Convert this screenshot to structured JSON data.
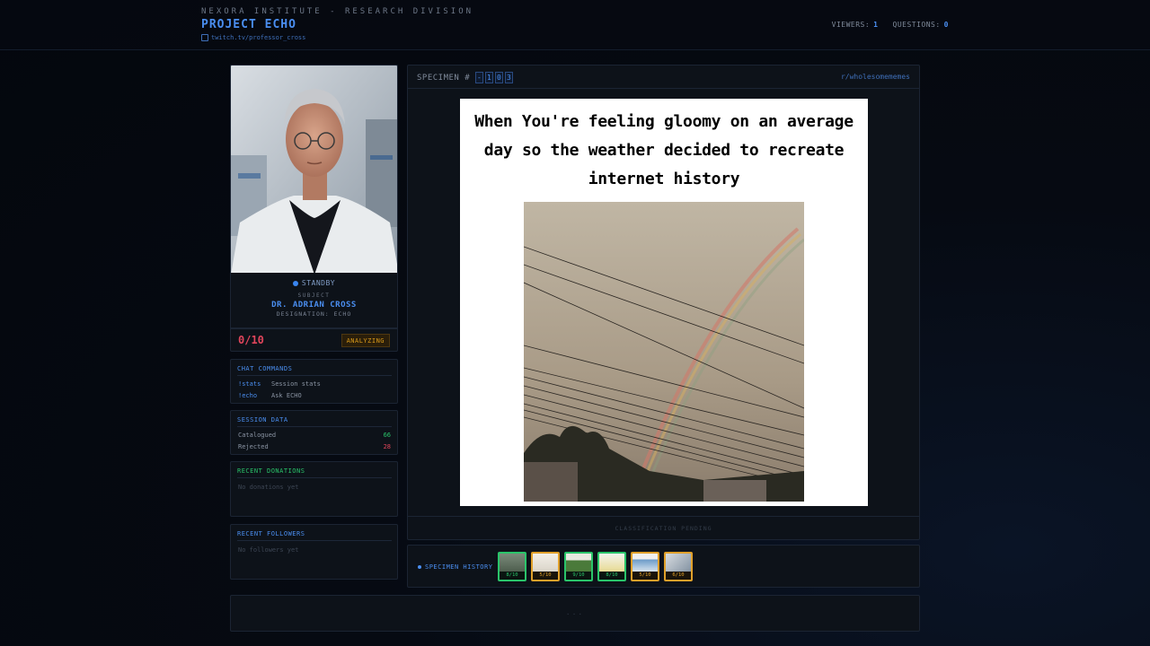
{
  "header": {
    "org": "NEXORA INSTITUTE - RESEARCH DIVISION",
    "project": "PROJECT ECHO",
    "stream": "twitch.tv/professor_cross",
    "viewers_label": "VIEWERS:",
    "viewers": "1",
    "questions_label": "QUESTIONS:",
    "questions": "0"
  },
  "subject": {
    "status": "STANDBY",
    "label": "SUBJECT",
    "name": "DR. ADRIAN CROSS",
    "designation": "DESIGNATION: ECHO",
    "score": "0/10",
    "state": "ANALYZING"
  },
  "commands": {
    "title": "CHAT COMMANDS",
    "items": [
      {
        "cmd": "!stats",
        "desc": "Session stats"
      },
      {
        "cmd": "!echo",
        "desc": "Ask ECHO"
      }
    ]
  },
  "session": {
    "title": "SESSION DATA",
    "catalogued_label": "Catalogued",
    "catalogued": "66",
    "rejected_label": "Rejected",
    "rejected": "28"
  },
  "donations": {
    "title": "RECENT DONATIONS",
    "empty": "No donations yet"
  },
  "followers": {
    "title": "RECENT FOLLOWERS",
    "empty": "No followers yet"
  },
  "specimen": {
    "label": "SPECIMEN #",
    "digits": [
      "-",
      "1",
      "0",
      "3"
    ],
    "subreddit": "r/wholesomememes",
    "caption": "When You're feeling gloomy on an average day so the weather decided to recreate internet history",
    "classification": "CLASSIFICATION PENDING"
  },
  "history": {
    "label": "SPECIMEN HISTORY",
    "items": [
      {
        "score": "8/10",
        "tone": "green"
      },
      {
        "score": "5/10",
        "tone": "amber"
      },
      {
        "score": "9/10",
        "tone": "green"
      },
      {
        "score": "8/10",
        "tone": "green"
      },
      {
        "score": "5/10",
        "tone": "amber"
      },
      {
        "score": "6/10",
        "tone": "amber"
      }
    ]
  },
  "footer": {
    "placeholder": "..."
  },
  "colors": {
    "accent": "#4a8ef0",
    "green": "#2ac46a",
    "red": "#e0455b",
    "amber": "#d99a1a"
  }
}
